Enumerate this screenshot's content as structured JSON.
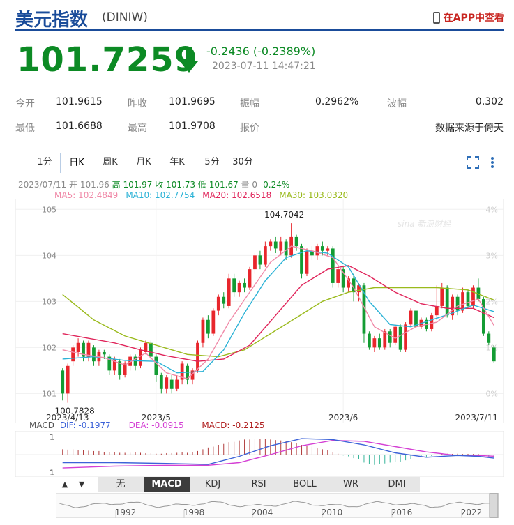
{
  "header": {
    "title": "美元指数",
    "code": "(DINIW)",
    "app_link": "在APP中查看"
  },
  "quote": {
    "price": "101.7259",
    "change": "-0.2436 (-0.2389%)",
    "time": "2023-07-11 14:47:21",
    "color_down": "#0c8a24"
  },
  "stats": [
    {
      "label": "今开",
      "value": "101.9615"
    },
    {
      "label": "昨收",
      "value": "101.9695"
    },
    {
      "label": "振幅",
      "value": "0.2962%"
    },
    {
      "label": "波幅",
      "value": "0.302"
    },
    {
      "label": "最低",
      "value": "101.6688"
    },
    {
      "label": "最高",
      "value": "101.9708"
    },
    {
      "label": "报价",
      "value": ""
    },
    {
      "label": "",
      "value": "数据来源于倚天"
    }
  ],
  "period_tabs": [
    "1分",
    "日K",
    "周K",
    "月K",
    "年K",
    "5分",
    "30分"
  ],
  "active_period": "日K",
  "info_line": {
    "date": "2023/07/11",
    "open": "开 101.96",
    "high": "高 101.97",
    "close": "收 101.73",
    "low": "低 101.67",
    "vol": "量 0",
    "pct": "-0.24%"
  },
  "ma_legend": [
    {
      "label": "MA5: 102.4849",
      "color": "#f08aa8"
    },
    {
      "label": "MA10: 102.7754",
      "color": "#2bb2d6"
    },
    {
      "label": "MA20: 102.6518",
      "color": "#e0245a"
    },
    {
      "label": "MA30: 103.0320",
      "color": "#9aba1c"
    }
  ],
  "macd_legend": {
    "title": "MACD",
    "dif": "DIF: -0.1977",
    "dea": "DEA: -0.0915",
    "macd": "MACD: -0.2125"
  },
  "indicator_tabs": [
    "无",
    "MACD",
    "KDJ",
    "RSI",
    "BOLL",
    "WR",
    "DMI"
  ],
  "active_indicator": "MACD",
  "watermark": "sina 新浪财经",
  "chart_data": {
    "type": "candlestick",
    "x_labels": [
      "2023/4/13",
      "2023/5",
      "2023/6",
      "2023/7/11"
    ],
    "y_ticks": [
      "105",
      "104",
      "103",
      "102",
      "101"
    ],
    "pct_ticks": [
      "4%",
      "3%",
      "2%",
      "1%",
      "0%"
    ],
    "ylim": [
      100.9,
      105.05
    ],
    "max_label": "104.7042",
    "min_label": "100.7828",
    "candles": [
      [
        101.5,
        101.0,
        101.55,
        100.85
      ],
      [
        101.0,
        101.6,
        101.65,
        100.8
      ],
      [
        101.7,
        102.0,
        102.05,
        101.6
      ],
      [
        101.9,
        102.1,
        102.2,
        101.8
      ],
      [
        102.1,
        101.8,
        102.15,
        101.7
      ],
      [
        101.8,
        102.1,
        102.15,
        101.7
      ],
      [
        102.0,
        101.7,
        102.05,
        101.6
      ],
      [
        101.7,
        101.9,
        101.95,
        101.6
      ],
      [
        101.9,
        101.85,
        101.95,
        101.75
      ],
      [
        101.8,
        101.5,
        101.85,
        101.4
      ],
      [
        101.5,
        101.75,
        101.8,
        101.4
      ],
      [
        101.7,
        101.4,
        101.75,
        101.3
      ],
      [
        101.4,
        101.65,
        101.7,
        101.35
      ],
      [
        101.6,
        101.8,
        101.85,
        101.5
      ],
      [
        101.8,
        101.6,
        101.85,
        101.5
      ],
      [
        101.6,
        101.95,
        102.0,
        101.55
      ],
      [
        101.9,
        102.1,
        102.15,
        101.85
      ],
      [
        102.1,
        101.8,
        102.15,
        101.7
      ],
      [
        101.8,
        101.4,
        101.85,
        101.25
      ],
      [
        101.4,
        101.1,
        101.45,
        101.0
      ],
      [
        101.1,
        101.35,
        101.4,
        101.0
      ],
      [
        101.3,
        101.1,
        101.4,
        101.0
      ],
      [
        101.1,
        101.3,
        101.4,
        101.05
      ],
      [
        101.3,
        101.65,
        101.7,
        101.2
      ],
      [
        101.6,
        101.3,
        101.65,
        101.2
      ],
      [
        101.3,
        101.5,
        101.55,
        101.2
      ],
      [
        101.5,
        102.1,
        102.15,
        101.45
      ],
      [
        102.1,
        102.6,
        102.65,
        102.0
      ],
      [
        102.6,
        102.3,
        102.7,
        102.2
      ],
      [
        102.3,
        102.8,
        102.85,
        102.25
      ],
      [
        102.8,
        103.1,
        103.15,
        102.7
      ],
      [
        103.1,
        102.95,
        103.2,
        102.85
      ],
      [
        102.9,
        103.5,
        103.6,
        102.85
      ],
      [
        103.5,
        103.2,
        103.6,
        103.1
      ],
      [
        103.2,
        103.4,
        103.45,
        103.1
      ],
      [
        103.4,
        103.3,
        103.5,
        103.2
      ],
      [
        103.3,
        103.7,
        103.75,
        103.25
      ],
      [
        103.7,
        104.0,
        104.05,
        103.6
      ],
      [
        104.0,
        103.8,
        104.1,
        103.7
      ],
      [
        103.8,
        104.2,
        104.3,
        103.75
      ],
      [
        104.2,
        104.3,
        104.35,
        104.1
      ],
      [
        104.3,
        104.15,
        104.4,
        104.05
      ],
      [
        104.1,
        104.3,
        104.4,
        104.0
      ],
      [
        104.3,
        104.0,
        104.35,
        103.9
      ],
      [
        104.0,
        104.4,
        104.7,
        103.95
      ],
      [
        104.4,
        104.2,
        104.45,
        104.1
      ],
      [
        104.2,
        103.6,
        104.25,
        103.5
      ],
      [
        103.6,
        104.1,
        104.15,
        103.55
      ],
      [
        104.1,
        104.0,
        104.2,
        103.9
      ],
      [
        104.0,
        104.2,
        104.25,
        103.9
      ],
      [
        104.2,
        104.1,
        104.3,
        104.0
      ],
      [
        104.1,
        104.15,
        104.2,
        104.0
      ],
      [
        104.15,
        103.4,
        104.2,
        103.3
      ],
      [
        103.4,
        103.7,
        103.75,
        103.3
      ],
      [
        103.7,
        103.3,
        103.75,
        103.2
      ],
      [
        103.3,
        103.5,
        103.55,
        103.2
      ],
      [
        103.5,
        103.2,
        103.6,
        103.0
      ],
      [
        103.2,
        103.35,
        103.4,
        103.0
      ],
      [
        103.35,
        102.3,
        103.4,
        102.1
      ],
      [
        102.3,
        102.0,
        102.35,
        101.95
      ],
      [
        102.0,
        102.2,
        102.25,
        101.9
      ],
      [
        102.2,
        102.0,
        102.3,
        101.95
      ],
      [
        102.0,
        102.35,
        102.4,
        101.95
      ],
      [
        102.35,
        102.1,
        102.4,
        102.0
      ],
      [
        102.1,
        102.45,
        102.5,
        102.05
      ],
      [
        102.45,
        101.95,
        102.5,
        101.9
      ],
      [
        101.95,
        102.5,
        102.55,
        101.9
      ],
      [
        102.5,
        102.8,
        102.85,
        102.45
      ],
      [
        102.8,
        102.45,
        102.85,
        102.4
      ],
      [
        102.45,
        102.6,
        102.65,
        102.4
      ],
      [
        102.6,
        102.4,
        102.65,
        102.35
      ],
      [
        102.4,
        102.7,
        102.75,
        102.35
      ],
      [
        102.7,
        102.9,
        103.35,
        102.6
      ],
      [
        102.9,
        103.3,
        103.4,
        102.85
      ],
      [
        103.3,
        102.7,
        103.35,
        102.65
      ],
      [
        102.7,
        103.1,
        103.15,
        102.6
      ],
      [
        103.1,
        102.8,
        103.15,
        102.7
      ],
      [
        102.8,
        103.2,
        103.3,
        102.75
      ],
      [
        103.2,
        102.9,
        103.25,
        102.85
      ],
      [
        102.9,
        103.3,
        103.35,
        102.85
      ],
      [
        103.3,
        103.05,
        103.5,
        103.0
      ],
      [
        103.05,
        102.3,
        103.1,
        102.25
      ],
      [
        102.3,
        102.1,
        102.35,
        102.05
      ],
      [
        102.0,
        101.7,
        102.05,
        101.66
      ]
    ],
    "ma5": [
      [
        0,
        101.95
      ],
      [
        4,
        101.85
      ],
      [
        8,
        101.78
      ],
      [
        12,
        101.62
      ],
      [
        16,
        101.88
      ],
      [
        20,
        101.45
      ],
      [
        24,
        101.32
      ],
      [
        28,
        101.75
      ],
      [
        32,
        102.55
      ],
      [
        36,
        103.2
      ],
      [
        40,
        103.85
      ],
      [
        44,
        104.2
      ],
      [
        48,
        104.1
      ],
      [
        52,
        103.95
      ],
      [
        56,
        103.3
      ],
      [
        60,
        102.45
      ],
      [
        64,
        102.2
      ],
      [
        68,
        102.45
      ],
      [
        72,
        102.55
      ],
      [
        76,
        102.9
      ],
      [
        80,
        103.05
      ],
      [
        83,
        102.48
      ]
    ],
    "ma10": [
      [
        0,
        101.75
      ],
      [
        6,
        101.8
      ],
      [
        12,
        101.72
      ],
      [
        18,
        101.7
      ],
      [
        22,
        101.45
      ],
      [
        27,
        101.48
      ],
      [
        31,
        101.95
      ],
      [
        35,
        102.75
      ],
      [
        39,
        103.45
      ],
      [
        43,
        103.95
      ],
      [
        47,
        104.1
      ],
      [
        51,
        104.05
      ],
      [
        55,
        103.75
      ],
      [
        59,
        103.0
      ],
      [
        63,
        102.5
      ],
      [
        67,
        102.45
      ],
      [
        71,
        102.6
      ],
      [
        75,
        102.75
      ],
      [
        79,
        102.92
      ],
      [
        83,
        102.78
      ]
    ],
    "ma20": [
      [
        0,
        102.3
      ],
      [
        5,
        102.2
      ],
      [
        10,
        102.1
      ],
      [
        15,
        101.95
      ],
      [
        20,
        101.82
      ],
      [
        26,
        101.7
      ],
      [
        31,
        101.75
      ],
      [
        36,
        102.05
      ],
      [
        41,
        102.7
      ],
      [
        46,
        103.35
      ],
      [
        51,
        103.7
      ],
      [
        55,
        103.78
      ],
      [
        59,
        103.55
      ],
      [
        64,
        103.2
      ],
      [
        69,
        102.95
      ],
      [
        74,
        102.85
      ],
      [
        79,
        102.85
      ],
      [
        83,
        102.65
      ]
    ],
    "ma30": [
      [
        0,
        103.15
      ],
      [
        6,
        102.6
      ],
      [
        12,
        102.25
      ],
      [
        18,
        102.05
      ],
      [
        24,
        101.85
      ],
      [
        30,
        101.8
      ],
      [
        35,
        101.95
      ],
      [
        40,
        102.3
      ],
      [
        45,
        102.65
      ],
      [
        50,
        103.0
      ],
      [
        55,
        103.2
      ],
      [
        60,
        103.3
      ],
      [
        66,
        103.3
      ],
      [
        72,
        103.3
      ],
      [
        78,
        103.25
      ],
      [
        83,
        103.03
      ]
    ],
    "macd": {
      "ylim": [
        -1.1,
        1.1
      ],
      "y_ticks": [
        "1",
        "-1"
      ],
      "dif": [
        [
          0,
          -0.45
        ],
        [
          10,
          -0.45
        ],
        [
          20,
          -0.5
        ],
        [
          28,
          -0.55
        ],
        [
          34,
          -0.1
        ],
        [
          40,
          0.5
        ],
        [
          46,
          0.9
        ],
        [
          52,
          0.85
        ],
        [
          58,
          0.55
        ],
        [
          64,
          0.1
        ],
        [
          70,
          -0.15
        ],
        [
          76,
          -0.05
        ],
        [
          80,
          -0.1
        ],
        [
          83,
          -0.2
        ]
      ],
      "dea": [
        [
          0,
          -0.75
        ],
        [
          10,
          -0.65
        ],
        [
          20,
          -0.6
        ],
        [
          28,
          -0.6
        ],
        [
          34,
          -0.45
        ],
        [
          40,
          0.0
        ],
        [
          46,
          0.5
        ],
        [
          52,
          0.8
        ],
        [
          58,
          0.75
        ],
        [
          64,
          0.45
        ],
        [
          70,
          0.15
        ],
        [
          76,
          -0.05
        ],
        [
          80,
          -0.05
        ],
        [
          83,
          -0.09
        ]
      ],
      "hist": [
        0.3,
        0.28,
        0.3,
        0.25,
        0.25,
        0.22,
        0.2,
        0.2,
        0.15,
        0.12,
        0.12,
        0.1,
        0.1,
        0.1,
        0.12,
        0.1,
        0.08,
        0.08,
        0.05,
        0.05,
        0.08,
        0.08,
        0.1,
        0.12,
        0.1,
        0.12,
        0.2,
        0.3,
        0.4,
        0.45,
        0.55,
        0.6,
        0.7,
        0.72,
        0.8,
        0.85,
        0.85,
        0.88,
        0.9,
        0.9,
        0.85,
        0.82,
        0.8,
        0.75,
        0.7,
        0.65,
        0.55,
        0.5,
        0.45,
        0.35,
        0.3,
        0.25,
        0.15,
        0.05,
        -0.05,
        -0.1,
        -0.2,
        -0.25,
        -0.45,
        -0.55,
        -0.58,
        -0.55,
        -0.5,
        -0.45,
        -0.4,
        -0.4,
        -0.32,
        -0.25,
        -0.2,
        -0.15,
        -0.12,
        -0.08,
        -0.05,
        0.02,
        0.05,
        0.04,
        0.05,
        0.03,
        0.04,
        0.03,
        0.04,
        -0.05,
        -0.12,
        -0.21
      ]
    }
  },
  "overview": {
    "years": [
      "1992",
      "1998",
      "2004",
      "2010",
      "2016",
      "2022"
    ]
  }
}
